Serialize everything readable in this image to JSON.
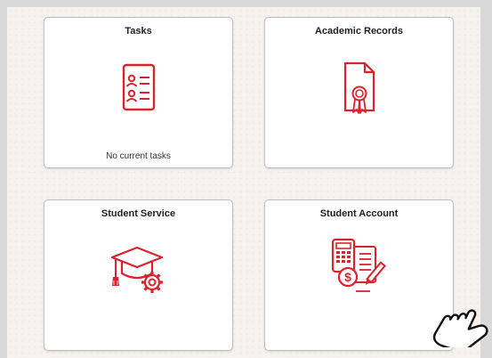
{
  "tiles": {
    "tasks": {
      "title": "Tasks",
      "status": "No current tasks",
      "icon": "id-card-icon"
    },
    "academic_records": {
      "title": "Academic Records",
      "icon": "certificate-document-icon"
    },
    "student_service": {
      "title": "Student Service",
      "icon": "graduation-cap-gear-icon"
    },
    "student_account": {
      "title": "Student Account",
      "icon": "calculator-payment-icon"
    }
  },
  "colors": {
    "icon_red": "#d9232d",
    "tile_border": "#bdbdbd",
    "background": "#f6f3ee"
  },
  "cursor": {
    "icon": "pointing-hand-icon"
  }
}
